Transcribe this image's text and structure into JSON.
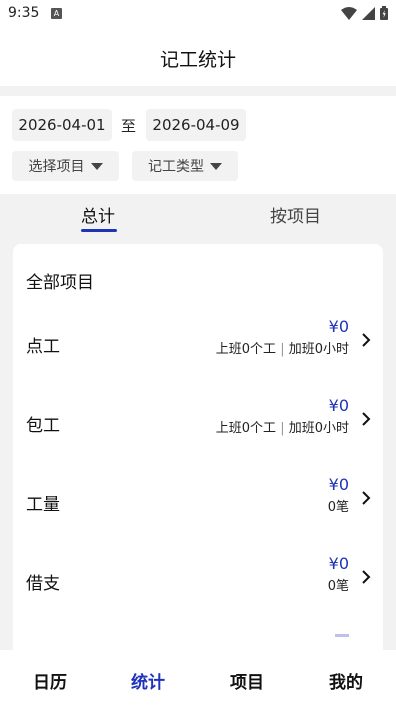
{
  "status_bar": {
    "time": "9:35",
    "notification_icon": "a-letter-icon",
    "icons": [
      "wifi-icon",
      "signal-icon",
      "battery-icon"
    ]
  },
  "app_bar": {
    "title": "记工统计"
  },
  "filters": {
    "start_date": "2026-04-01",
    "separator": "至",
    "end_date": "2026-04-09",
    "project_dropdown": "选择项目",
    "type_dropdown": "记工类型"
  },
  "tabs": {
    "total": "总计",
    "by_project": "按项目",
    "active": "total"
  },
  "card": {
    "title": "全部项目",
    "rows": [
      {
        "label": "点工",
        "amount": "¥0",
        "detail_a": "上班0个工",
        "divider": "|",
        "detail_b": "加班0小时"
      },
      {
        "label": "包工",
        "amount": "¥0",
        "detail_a": "上班0个工",
        "divider": "|",
        "detail_b": "加班0小时"
      },
      {
        "label": "工量",
        "amount": "¥0",
        "detail": "0笔"
      },
      {
        "label": "借支",
        "amount": "¥0",
        "detail": "0笔"
      }
    ]
  },
  "bottom_nav": {
    "items": [
      {
        "label": "日历"
      },
      {
        "label": "统计"
      },
      {
        "label": "项目"
      },
      {
        "label": "我的"
      }
    ],
    "active": "统计"
  },
  "colors": {
    "accent": "#1f33b8",
    "background_gray": "#f2f2f2",
    "chip_gray": "#f2f2f2"
  }
}
